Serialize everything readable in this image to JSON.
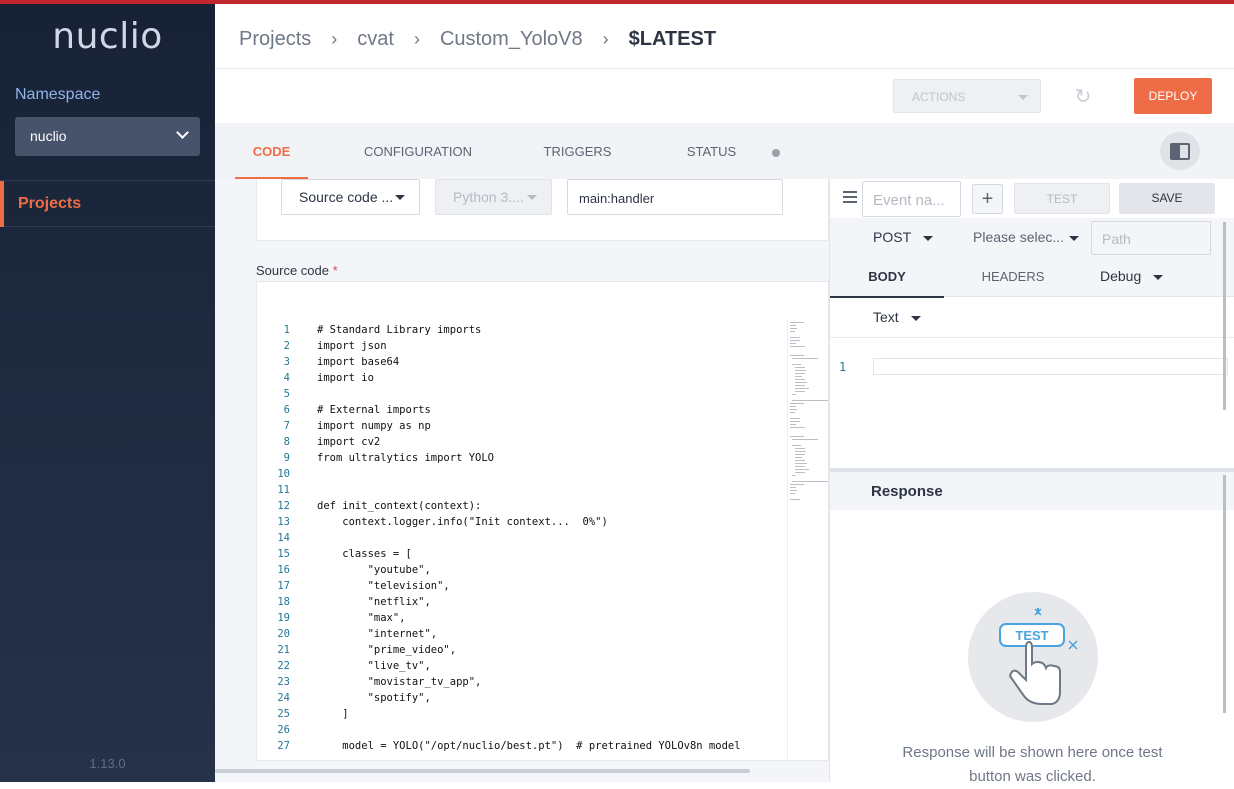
{
  "app": {
    "logo": "nuclio",
    "version": "1.13.0"
  },
  "sidebar": {
    "namespace_label": "Namespace",
    "namespace_value": "nuclio",
    "items": [
      {
        "label": "Projects",
        "active": true
      }
    ]
  },
  "breadcrumb": [
    "Projects",
    "cvat",
    "Custom_YoloV8",
    "$LATEST"
  ],
  "toolbar": {
    "actions_label": "ACTIONS",
    "deploy_label": "DEPLOY"
  },
  "tabs": [
    "CODE",
    "CONFIGURATION",
    "TRIGGERS",
    "STATUS"
  ],
  "code_panel": {
    "source_select": "Source code ...",
    "runtime_select": "Python 3....",
    "handler_value": "main:handler",
    "source_label": "Source code",
    "required_mark": "*",
    "lines": [
      "# Standard Library imports",
      "import json",
      "import base64",
      "import io",
      "",
      "# External imports",
      "import numpy as np",
      "import cv2",
      "from ultralytics import YOLO",
      "",
      "",
      "def init_context(context):",
      "    context.logger.info(\"Init context...  0%\")",
      "",
      "    classes = [",
      "        \"youtube\",",
      "        \"television\",",
      "        \"netflix\",",
      "        \"max\",",
      "        \"internet\",",
      "        \"prime_video\",",
      "        \"live_tv\",",
      "        \"movistar_tv_app\",",
      "        \"spotify\",",
      "    ]",
      "",
      "    model = YOLO(\"/opt/nuclio/best.pt\")  # pretrained YOLOv8n model"
    ]
  },
  "test_panel": {
    "event_name_placeholder": "Event na...",
    "add_label": "+",
    "test_label": "TEST",
    "save_label": "SAVE",
    "method": "POST",
    "content_type_placeholder": "Please selec...",
    "path_placeholder": "Path",
    "body_tab": "BODY",
    "headers_tab": "HEADERS",
    "log_level": "Debug",
    "body_format": "Text",
    "body_line_number": "1",
    "response_title": "Response",
    "response_illustration_label": "TEST",
    "response_message": "Response will be shown here once test button was clicked."
  },
  "colors": {
    "accent": "#ef6d46",
    "sidebar": "#1e2a40",
    "link_blue": "#4aa3df"
  }
}
